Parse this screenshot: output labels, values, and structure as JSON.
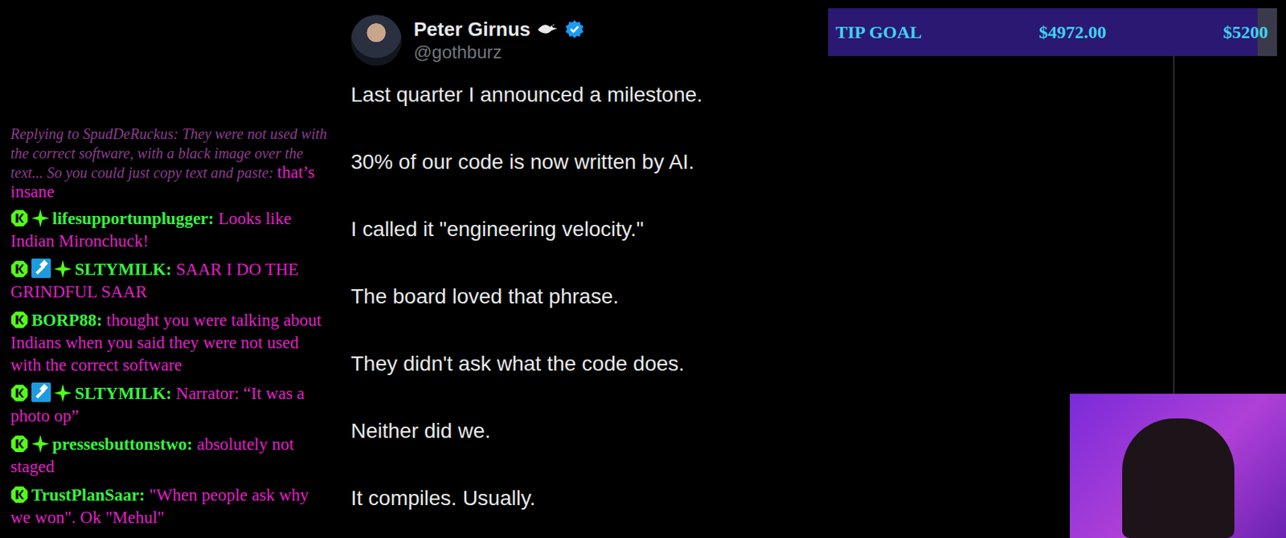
{
  "chat": {
    "messages": [
      {
        "kind": "reply",
        "reply_text": "Replying to SpudDeRuckus: They were not used with the correct software, with a black image over the text... So you could just copy text and paste:",
        "text": "that’s insane"
      },
      {
        "kind": "message",
        "user": "lifesupportunplugger:",
        "moderator": false,
        "sparkle": true,
        "text": "Looks like Indian Mironchuck!"
      },
      {
        "kind": "message",
        "user": "SLTYMILK:",
        "moderator": true,
        "sparkle": true,
        "text": "SAAR I DO THE GRINDFUL SAAR"
      },
      {
        "kind": "message",
        "user": "BORP88:",
        "moderator": false,
        "sparkle": false,
        "text": "thought you were talking about Indians when you said they were not used with the correct software"
      },
      {
        "kind": "message",
        "user": "SLTYMILK:",
        "moderator": true,
        "sparkle": true,
        "text": "Narrator: “It was a photo op”"
      },
      {
        "kind": "message",
        "user": "pressesbuttonstwo:",
        "moderator": false,
        "sparkle": true,
        "text": "absolutely not staged"
      },
      {
        "kind": "message",
        "user": "TrustPlanSaar:",
        "moderator": false,
        "sparkle": false,
        "text": "\"When people ask why we won\". Ok \"Mehul\""
      }
    ]
  },
  "tweet": {
    "author": {
      "name": "Peter Girnus",
      "verified": true,
      "handle": "@gothburz"
    },
    "paragraphs": [
      "Last quarter I announced a milestone.",
      "30% of our code is now written by AI.",
      "I called it \"engineering velocity.\"",
      "The board loved that phrase.",
      "They didn't ask what the code does.",
      "Neither did we.",
      "It compiles. Usually."
    ]
  },
  "tip_goal": {
    "label": "TIP GOAL",
    "current": "$4972.00",
    "goal": "$5200",
    "level": 0.956
  }
}
